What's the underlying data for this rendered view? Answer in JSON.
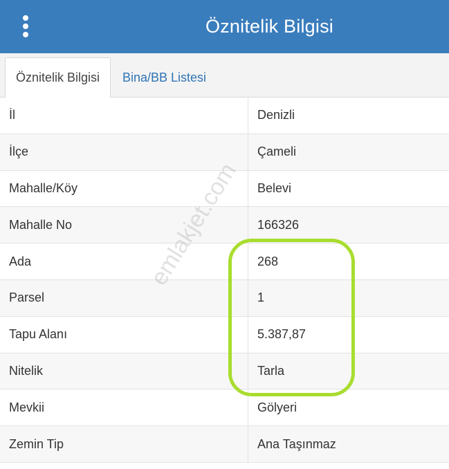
{
  "header": {
    "title": "Öznitelik Bilgisi",
    "menu_icon": "more-vertical-icon"
  },
  "tabs": [
    {
      "label": "Öznitelik Bilgisi",
      "active": true
    },
    {
      "label": "Bina/BB Listesi",
      "active": false
    }
  ],
  "rows": [
    {
      "key": "İl",
      "value": "Denizli"
    },
    {
      "key": "İlçe",
      "value": "Çameli"
    },
    {
      "key": "Mahalle/Köy",
      "value": "Belevi"
    },
    {
      "key": "Mahalle No",
      "value": "166326"
    },
    {
      "key": "Ada",
      "value": "268"
    },
    {
      "key": "Parsel",
      "value": "1"
    },
    {
      "key": "Tapu Alanı",
      "value": "5.387,87"
    },
    {
      "key": "Nitelik",
      "value": "Tarla"
    },
    {
      "key": "Mevkii",
      "value": "Gölyeri"
    },
    {
      "key": "Zemin Tip",
      "value": "Ana Taşınmaz"
    }
  ],
  "watermark": "emlakjet.com",
  "colors": {
    "header_bg": "#3a7dbd",
    "link": "#2f74b5",
    "highlight": "#a8dd2f"
  }
}
